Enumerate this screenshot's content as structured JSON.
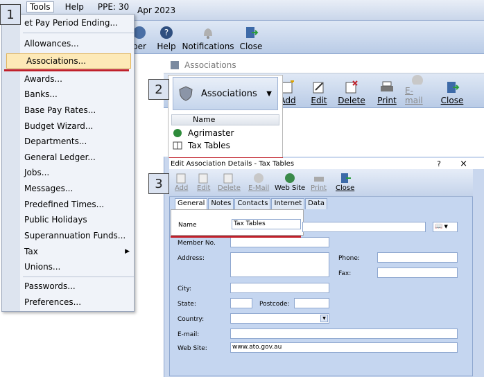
{
  "window": {
    "title_date": "Apr 2023"
  },
  "menubar": {
    "tools": "Tools",
    "help": "Help",
    "ppe": "PPE: 30"
  },
  "main_toolbar": {
    "buttons": [
      {
        "label": "per"
      },
      {
        "label": "Help"
      },
      {
        "label": "Notifications"
      },
      {
        "label": "Close"
      }
    ]
  },
  "tools_menu": {
    "items": [
      {
        "label": "et Pay Period Ending..."
      },
      {
        "label": "Allowances..."
      },
      {
        "label": "Associations..."
      },
      {
        "label": "Awards..."
      },
      {
        "label": "Banks..."
      },
      {
        "label": "Base Pay Rates..."
      },
      {
        "label": "Budget Wizard..."
      },
      {
        "label": "Departments..."
      },
      {
        "label": "General Ledger..."
      },
      {
        "label": "Jobs..."
      },
      {
        "label": "Messages..."
      },
      {
        "label": "Predefined Times..."
      },
      {
        "label": "Public Holidays"
      },
      {
        "label": "Superannuation Funds..."
      },
      {
        "label": "Tax"
      },
      {
        "label": "Unions..."
      },
      {
        "label": "Passwords..."
      },
      {
        "label": "Preferences..."
      }
    ]
  },
  "markers": {
    "m1": "1",
    "m2": "2",
    "m3": "3"
  },
  "associations_window": {
    "title": "Associations",
    "toolbar": [
      {
        "label": "Add"
      },
      {
        "label": "Edit"
      },
      {
        "label": "Delete"
      },
      {
        "label": "Print"
      },
      {
        "label": "E-mail"
      },
      {
        "label": "Close"
      }
    ],
    "dropdown_label": "Associations",
    "column_name": "Name",
    "rows": [
      {
        "name": "Agrimaster"
      },
      {
        "name": "Tax Tables"
      }
    ]
  },
  "edit_window": {
    "title": "Edit Association Details - Tax Tables",
    "help_glyph": "?",
    "close_glyph": "×",
    "toolbar": [
      {
        "label": "Add"
      },
      {
        "label": "Edit"
      },
      {
        "label": "Delete"
      },
      {
        "label": "E-Mail"
      },
      {
        "label": "Web Site"
      },
      {
        "label": "Print"
      },
      {
        "label": "Close"
      }
    ],
    "tabs": [
      {
        "label": "General"
      },
      {
        "label": "Notes"
      },
      {
        "label": "Contacts"
      },
      {
        "label": "Internet"
      },
      {
        "label": "Data"
      }
    ],
    "labels": {
      "name": "Name",
      "member_no": "Member No.",
      "address": "Address:",
      "phone": "Phone:",
      "fax": "Fax:",
      "city": "City:",
      "state": "State:",
      "postcode": "Postcode:",
      "country": "Country:",
      "email": "E-mail:",
      "website": "Web Site:"
    },
    "values": {
      "name": "Tax Tables",
      "website": "www.ato.gov.au"
    }
  }
}
